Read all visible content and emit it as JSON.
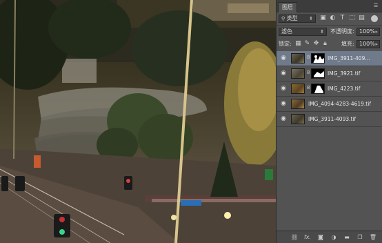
{
  "panel": {
    "tab": "图层",
    "menu_icon": "panel-menu-icon",
    "filter": {
      "label": "类型",
      "icons": [
        "image-filter-icon",
        "adjustment-filter-icon",
        "text-filter-icon",
        "shape-filter-icon",
        "smart-object-filter-icon"
      ],
      "text_icon_glyph": "T"
    },
    "blend_mode": "滤色",
    "opacity_label": "不透明度:",
    "opacity_value": "100%",
    "lock_label": "锁定:",
    "fill_label": "填充:",
    "fill_value": "100%",
    "layers": [
      {
        "name": "IMG_3911-409...",
        "active": true,
        "has_mask": true
      },
      {
        "name": "IMG_3921.tif",
        "active": false,
        "has_mask": true
      },
      {
        "name": "IMG_4223.tif",
        "active": false,
        "has_mask": true
      },
      {
        "name": "IMG_4094-4283-4619.tif",
        "active": false,
        "has_mask": false
      },
      {
        "name": "IMG_3911-4093.tif",
        "active": false,
        "has_mask": false
      }
    ],
    "bottom_icons": [
      "link-layers-icon",
      "fx-icon",
      "add-mask-icon",
      "adjustment-layer-icon",
      "new-group-icon",
      "new-layer-icon",
      "delete-icon"
    ],
    "fx_glyph": "fx."
  },
  "colors": {
    "panel_bg": "#535353",
    "active_layer": "#6f7a8a",
    "panel_dark": "#3c3c3c"
  }
}
